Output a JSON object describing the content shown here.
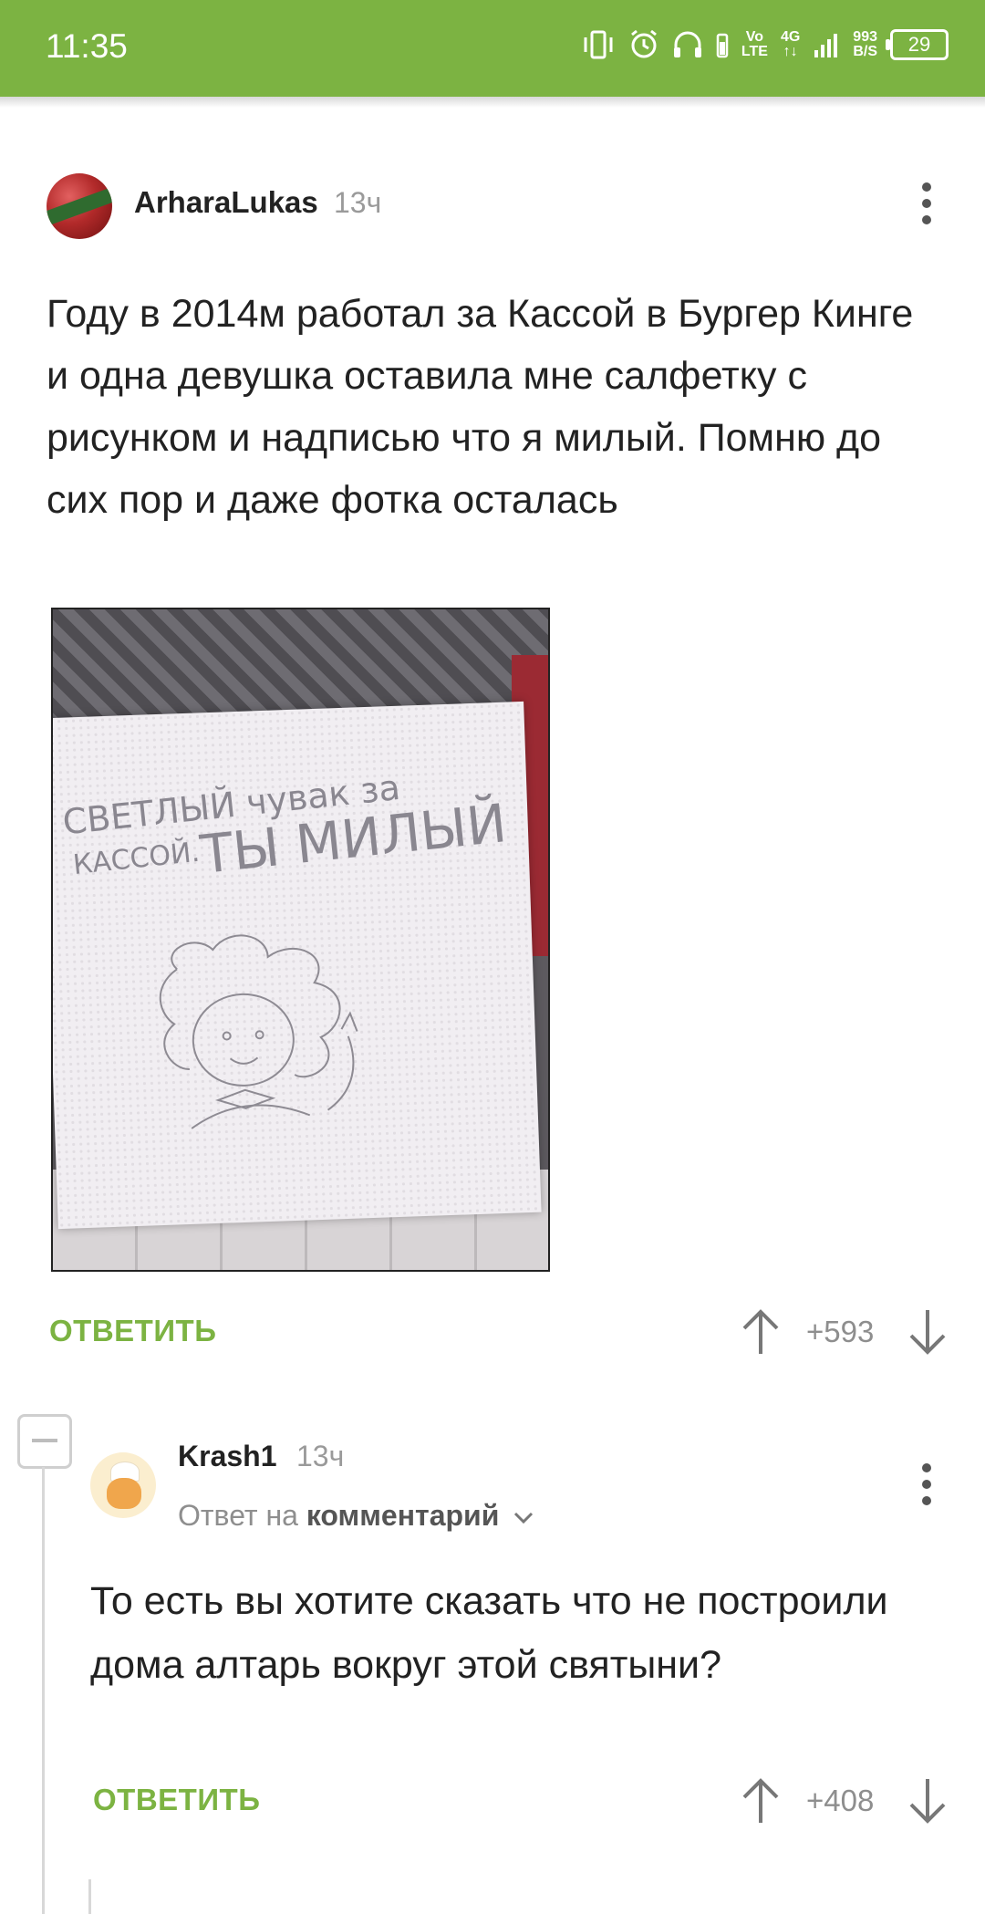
{
  "status_bar": {
    "time": "11:35",
    "net_lte_top": "Vo",
    "net_lte_bottom": "LTE",
    "net_4g": "4G",
    "speed_top": "993",
    "speed_bottom": "B/S",
    "battery": "29",
    "icons": [
      "vibrate-icon",
      "alarm-icon",
      "headphones-icon",
      "signal-icon",
      "battery-icon"
    ],
    "color": "#7cb342"
  },
  "post": {
    "author": "ArharaLukas",
    "time": "13ч",
    "text": "Году в 2014м работал за Кассой в Бургер Кинге и одна девушка оставила мне салфетку с рисунком и надписью что я милый. Помню до сих пор и даже фотка осталась",
    "reply_label": "ОТВЕТИТЬ",
    "rating": "+593"
  },
  "comment": {
    "author": "Krash1",
    "time": "13ч",
    "reply_to_prefix": "Ответ на",
    "reply_to_target": "комментарий",
    "text": "То есть вы хотите сказать что не построили дома алтарь вокруг этой святыни?",
    "reply_label": "ОТВЕТИТЬ",
    "rating": "+408"
  },
  "accent_color": "#7cb342"
}
